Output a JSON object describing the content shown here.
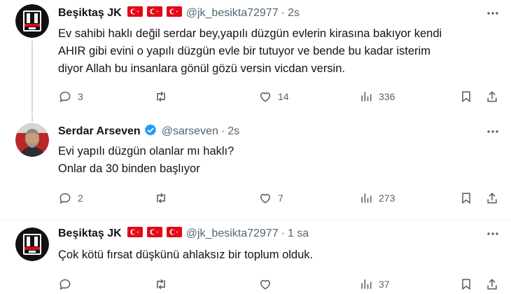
{
  "tweets": [
    {
      "name": "Beşiktaş JK",
      "handle": "@jk_besikta72977",
      "dot": "·",
      "time": "2s",
      "lines": [
        "Ev sahibi haklı değil serdar bey,yapılı düzgün evlerin kirasına bakıyor kendi",
        "AHIR gibi evini o yapılı düzgün evle bir tutuyor ve bende bu kadar isterim",
        "diyor Allah bu insanlara gönül gözü versin vicdan versin."
      ],
      "replies": "3",
      "retweets": "",
      "likes": "14",
      "views": "336"
    },
    {
      "name": "Serdar Arseven",
      "handle": "@sarseven",
      "dot": "·",
      "time": "2s",
      "lines": [
        "Evi yapılı düzgün olanlar mı haklı?",
        "Onlar da 30 binden başlıyor"
      ],
      "replies": "2",
      "retweets": "",
      "likes": "7",
      "views": "273"
    },
    {
      "name": "Beşiktaş JK",
      "handle": "@jk_besikta72977",
      "dot": "·",
      "time": "1 sa",
      "lines": [
        "Çok kötü fırsat düşkünü ahlaksız bir toplum olduk."
      ],
      "replies": "",
      "retweets": "",
      "likes": "",
      "views": "37"
    }
  ],
  "colors": {
    "text": "#0f1419",
    "secondary": "#536471",
    "verified": "#1d9bf0",
    "flag_red": "#e30a17",
    "separator": "#eff3f4"
  },
  "icons": [
    "bjk-logo",
    "turkey-flag-icon",
    "verified-badge-icon",
    "more-icon",
    "reply-icon",
    "retweet-icon",
    "like-icon",
    "views-icon",
    "bookmark-icon",
    "share-icon"
  ]
}
